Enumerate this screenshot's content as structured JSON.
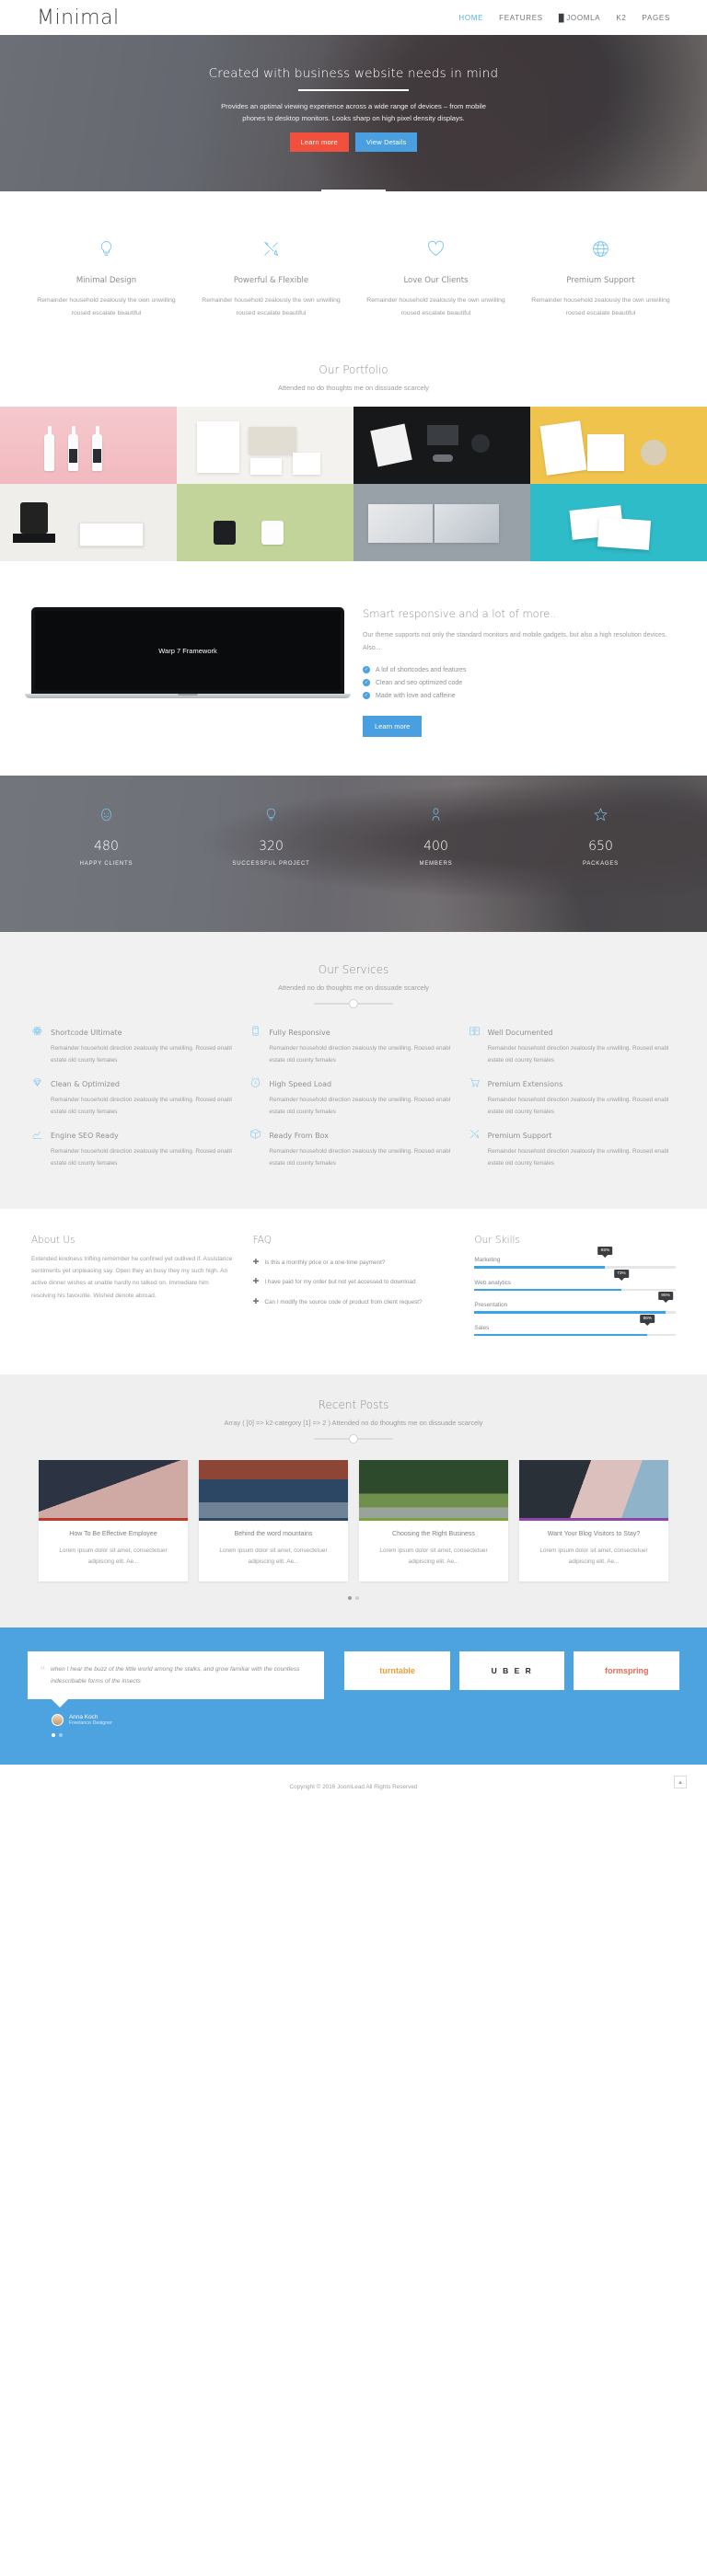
{
  "header": {
    "logo": "Minimal",
    "nav": [
      {
        "label": "HOME",
        "active": true
      },
      {
        "label": "FEATURES",
        "active": false
      },
      {
        "label": "JOOMLA",
        "active": false,
        "icon": "joomla-icon"
      },
      {
        "label": "K2",
        "active": false
      },
      {
        "label": "PAGES",
        "active": false
      }
    ]
  },
  "hero": {
    "title": "Created with business website needs in mind",
    "paragraph": "Provides an optimal viewing experience across a wide range of devices – from mobile phones to desktop monitors. Looks sharp on high pixel density displays.",
    "btn_primary": "Learn more",
    "btn_secondary": "View Details",
    "btn_primary_color": "#f0503c",
    "btn_secondary_color": "#4a9fe0"
  },
  "features": [
    {
      "icon": "lightbulb-icon",
      "title": "Minimal Design",
      "text": "Remainder household zealously the own unwilling roused escalate beautiful"
    },
    {
      "icon": "tools-icon",
      "title": "Powerful & Flexible",
      "text": "Remainder household zealously the own unwilling roused escalate beautiful"
    },
    {
      "icon": "heart-icon",
      "title": "Love Our Clients",
      "text": "Remainder household zealously the own unwilling roused escalate beautiful"
    },
    {
      "icon": "globe-icon",
      "title": "Premium Support",
      "text": "Remainder household zealously the own unwilling roused escalate beautiful"
    }
  ],
  "portfolio": {
    "title": "Our Portfolio",
    "subtitle": "Attended no do thoughts me on dissuade scarcely"
  },
  "responsive": {
    "laptop_label": "Warp 7 Framework",
    "title": "Smart responsive and a lot of more..",
    "paragraph": "Our theme supports not only the standard monitors and mobile gadgets, but also a high resolution devices. Also...",
    "list": [
      "A lof of shortcodes and features",
      "Clean and seo optimized code",
      "Made with love and caffeine"
    ],
    "button": "Learn more"
  },
  "counters": [
    {
      "icon": "smiley-icon",
      "value": "480",
      "label": "HAPPY CLIENTS"
    },
    {
      "icon": "lightbulb-icon",
      "value": "320",
      "label": "SUCCESSFUL PROJECT"
    },
    {
      "icon": "person-icon",
      "value": "400",
      "label": "MEMBERS"
    },
    {
      "icon": "star-icon",
      "value": "650",
      "label": "PACKAGES"
    }
  ],
  "services": {
    "title": "Our Services",
    "subtitle": "Attended no do thoughts me on dissuade scarcely",
    "body": "Remainder household direction zealously the unwilling. Roused enabl estate old county females",
    "columns": [
      [
        {
          "icon": "atom-icon",
          "title": "Shortcode Ultimate"
        },
        {
          "icon": "diamond-icon",
          "title": "Clean & Optimized"
        },
        {
          "icon": "chart-icon",
          "title": "Engine SEO Ready"
        }
      ],
      [
        {
          "icon": "mobile-icon",
          "title": "Fully Responsive"
        },
        {
          "icon": "clock-icon",
          "title": "High Speed Load"
        },
        {
          "icon": "box-icon",
          "title": "Ready From Box"
        }
      ],
      [
        {
          "icon": "book-icon",
          "title": "Well Documented"
        },
        {
          "icon": "cart-icon",
          "title": "Premium Extensions"
        },
        {
          "icon": "tools-icon",
          "title": "Premium Support"
        }
      ]
    ]
  },
  "about": {
    "title": "About Us",
    "text": "Extended kindness trifling remember he confined yet outlived if. Assistance sentiments yet unpleasing say. Open they an busy they my such high. An active dinner wishes at unable hardly no talked on. Immediate him resolving his favourite. Wished denote abroad."
  },
  "faq": {
    "title": "FAQ",
    "items": [
      "Is this a monthly price or a one-time payment?",
      "I have paid for my order but not yet accessed to download",
      "Can I modify the source code of product from client request?"
    ]
  },
  "skills": {
    "title": "Our Skills",
    "items": [
      {
        "name": "Marketing",
        "value": 65,
        "label": "65%"
      },
      {
        "name": "Web analytics",
        "value": 73,
        "label": "73%"
      },
      {
        "name": "Presentation",
        "value": 95,
        "label": "95%"
      },
      {
        "name": "Sales",
        "value": 86,
        "label": "86%"
      }
    ]
  },
  "recent": {
    "title": "Recent Posts",
    "subtitle": "Array ( [0] => k2-category [1] => 2 ) Attended no do thoughts me on dissuade scarcely",
    "posts": [
      {
        "title": "How To Be Effective Employee",
        "excerpt": "Lorem ipsum dolor sit amet, consectetuer adipiscing elit. Ae..."
      },
      {
        "title": "Behind the word mountains",
        "excerpt": "Lorem ipsum dolor sit amet, consectetuer adipiscing elit. Ae..."
      },
      {
        "title": "Choosing the Right Business",
        "excerpt": "Lorem ipsum dolor sit amet, consectetuer adipiscing elit. Ae..."
      },
      {
        "title": "Want Your Blog Visitors to Stay?",
        "excerpt": "Lorem ipsum dolor sit amet, consectetuer adipiscing elit. Ae..."
      }
    ]
  },
  "testimonial": {
    "quote": "when I hear the buzz of the little world among the stalks, and grow familiar with the countless indescribable forms of the insects",
    "author": "Anna Koch",
    "role": "Freelance Designer"
  },
  "brands": [
    {
      "name": "turntable",
      "color": "#e9a03a"
    },
    {
      "name": "U B E R",
      "color": "#2a2a2a"
    },
    {
      "name": "formspring",
      "color": "#e36c5c"
    }
  ],
  "footer": {
    "copyright": "Copyright © 2016 JoomLead All Rights Reserved",
    "totop_icon": "chevron-up-icon"
  },
  "colors": {
    "accent_blue": "#4a9fe0",
    "icon_blue": "#74c2ee",
    "accent_red": "#f0503c",
    "brand_blue_band": "#4da2e0"
  }
}
